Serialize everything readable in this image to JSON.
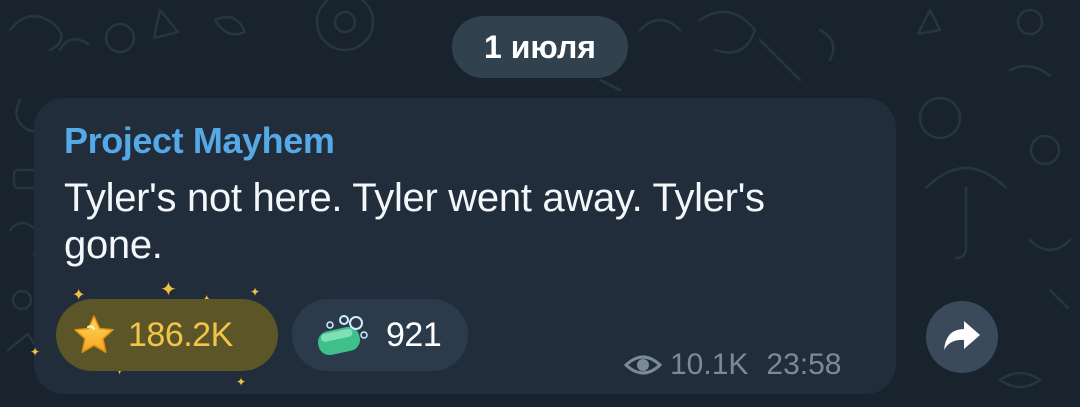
{
  "date_divider": "1 июля",
  "message": {
    "sender": "Project Mayhem",
    "text": "Tyler's not here. Tyler went away. Tyler's gone.",
    "reactions": [
      {
        "icon": "star-icon",
        "count": "186.2K"
      },
      {
        "icon": "soap-icon",
        "count": "921"
      }
    ],
    "views": "10.1K",
    "time": "23:58"
  },
  "forward_icon": "forward-arrow-icon",
  "colors": {
    "background": "#18232d",
    "bubble": "#212d3b",
    "sender": "#55a9e6",
    "star_reaction_bg": "#5b5527",
    "star_reaction_text": "#f2c548",
    "reaction_bg": "#2c3b4b",
    "meta_text": "#7a8a98"
  }
}
